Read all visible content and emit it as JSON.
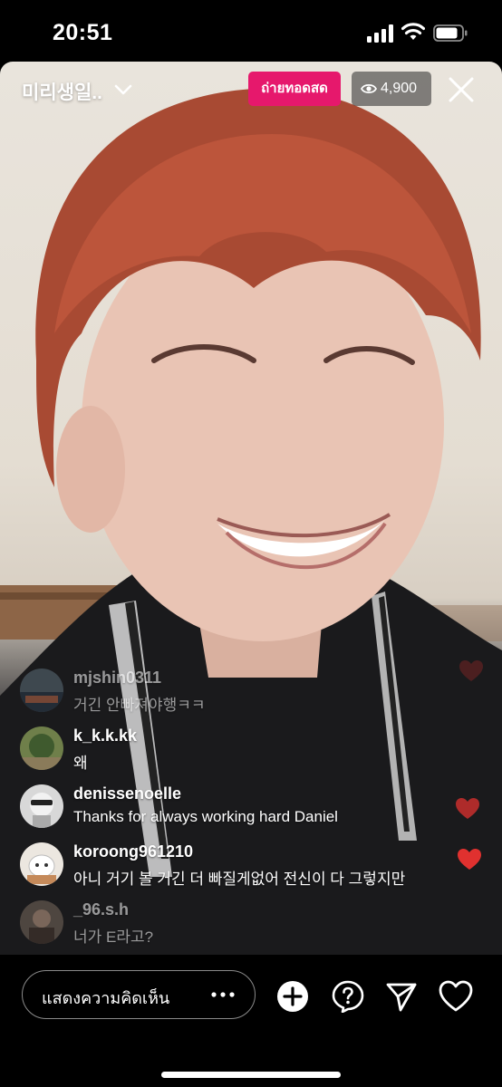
{
  "status_bar": {
    "time": "20:51"
  },
  "live": {
    "channel_name": "미리생일..",
    "live_label": "ถ่ายทอดสด",
    "viewer_count": "4,900"
  },
  "comments": [
    {
      "username": "mjshin0311",
      "text": "거긴 안빠져야행ㅋㅋ"
    },
    {
      "username": "k_k.k.kk",
      "text": "왜"
    },
    {
      "username": "denissenoelle",
      "text": "Thanks for always working hard Daniel"
    },
    {
      "username": "koroong961210",
      "text": "아니 거기 볼 거긴 더 빠질게없어 전신이 다 그렇지만"
    },
    {
      "username": "_96.s.h",
      "text": "너가 E라고?"
    }
  ],
  "bottom_bar": {
    "comment_placeholder": "แสดงความคิดเห็น",
    "more_label": "•••"
  },
  "colors": {
    "live_badge": "#e6186c",
    "heart": "#e0312f"
  },
  "icons": [
    "chevron-down-icon",
    "eye-icon",
    "close-icon",
    "more-icon",
    "add-icon",
    "question-icon",
    "send-icon",
    "heart-icon"
  ]
}
